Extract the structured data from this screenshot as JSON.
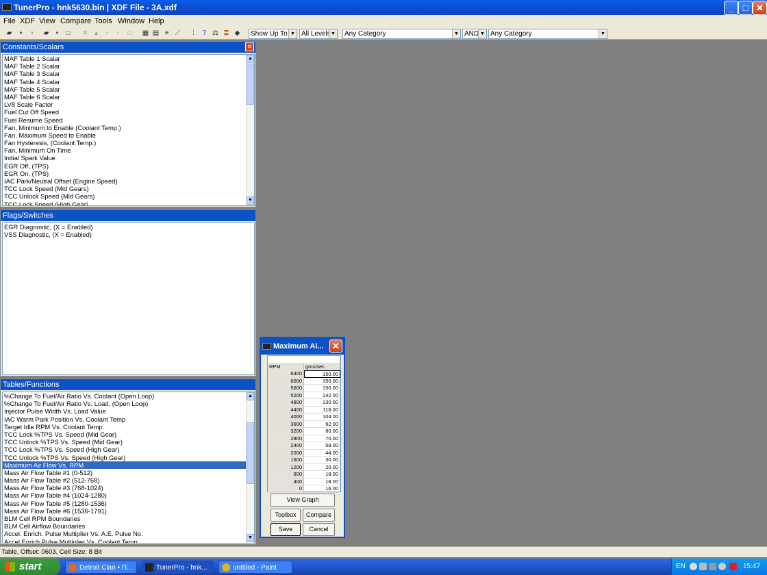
{
  "window": {
    "title": "TunerPro - hnk5630.bin | XDF File - 3A.xdf",
    "min": "_",
    "max": "□",
    "close": "✕"
  },
  "menu": [
    "File",
    "XDF",
    "View",
    "Compare",
    "Tools",
    "Window",
    "Help"
  ],
  "toolbar": {
    "icons": [
      "open-icon",
      "save-icon",
      "unlock-icon",
      "open-xdf-icon",
      "save-xdf-icon",
      "xdf-icon",
      "new-icon",
      "cut-icon",
      "tool-a-icon",
      "tool-b-icon",
      "tool-c-icon",
      "tool-d-icon",
      "table-icon",
      "table2-icon",
      "list-icon",
      "graph-icon",
      "gauge-icon",
      "help-icon",
      "balance-icon",
      "stack-icon",
      "chip-icon"
    ],
    "combo_show": "Show Up To",
    "combo_levels": "All Levels",
    "combo_category1": "Any Category",
    "combo_and": "AND",
    "combo_category2": "Any Category"
  },
  "constants": {
    "title": "Constants/Scalars",
    "items": [
      "MAF Table 1 Scalar",
      "MAF Table 2 Scalar",
      "MAF Table 3 Scalar",
      "MAF Table 4 Scalar",
      "MAF Table 5 Scalar",
      "MAF Table 6 Scalar",
      "LV8 Scale Factor",
      "Fuel Cut Off Speed",
      "Fuel  Resume Speed",
      "Fan, Minimum to Enable (Coolant Temp.)",
      "Fan. Maximum Speed to Enable",
      "Fan Hysteresis, (Coolant Temp.)",
      "Fan, Minimum On Time",
      "Initial  Spark Value",
      "EGR Off, (TPS)",
      "EGR On, (TPS)",
      "IAC Park/Neutral Offset (Engine Speed)",
      "TCC Lock Speed (Mid Gears)",
      "TCC Unlock Speed (Mid Gears)",
      "TCC Lock Speed (High Gear)"
    ]
  },
  "flags": {
    "title": "Flags/Switches",
    "items": [
      "EGR Diagnostic, (X = Enabled)",
      "VSS Diagnostic, (X = Enabled)"
    ]
  },
  "tables": {
    "title": "Tables/Functions",
    "selected_index": 9,
    "items": [
      "%Change To Fuel/Air Ratio Vs. Coolant (Open Loop)",
      "%Change To Fuel/Air Ratio Vs. Load, (Open Loop)",
      "Injector Pulse Width Vs. Load Value",
      "IAC Warm Park Position Vs. Coolant Temp",
      "Target Idle RPM Vs. Coolant Temp.",
      "TCC Lock %TPS Vs. Speed (Mid Gear)",
      "TCC Unlock %TPS Vs. Speed (Mid Gear)",
      "TCC Lock %TPS Vs. Speed (High Gear)",
      "TCC Unlock %TPS Vs. Speed (High Gear)",
      "Maximum  Air Flow Vs. RPM",
      "Mass Air Flow Table #1  (0-512)",
      "Mass Air Flow Table #2  (512-768)",
      "Mass Air Flow Table #3  (768-1024)",
      "Mass Air Flow Table #4  (1024-1280)",
      "Mass Air Flow Table #5  (1280-1536)",
      "Mass Air Flow Table #6  (1536-1791)",
      "BLM Cell RPM Boundaries",
      "BLM Cell Airflow Boundaries",
      "Accel. Enrich. Pulse Multiplier Vs. A.E. Pulse No.",
      "Accel Enrich Pulse Multiplier Vs. Coolant Temp"
    ]
  },
  "dialog": {
    "title": "Maximum  Ai...",
    "col_rpm": "RPM",
    "col_val": "gms/sec",
    "rows": [
      [
        "6400",
        "150.00"
      ],
      [
        "6000",
        "150.00"
      ],
      [
        "5600",
        "150.00"
      ],
      [
        "5200",
        "142.00"
      ],
      [
        "4800",
        "130.00"
      ],
      [
        "4400",
        "118.00"
      ],
      [
        "4000",
        "104.00"
      ],
      [
        "3600",
        "92.00"
      ],
      [
        "3200",
        "80.00"
      ],
      [
        "2800",
        "70.00"
      ],
      [
        "2400",
        "58.00"
      ],
      [
        "2000",
        "44.00"
      ],
      [
        "1600",
        "30.00"
      ],
      [
        "1200",
        "20.00"
      ],
      [
        "800",
        "18.00"
      ],
      [
        "400",
        "18.00"
      ],
      [
        "0",
        "16.00"
      ]
    ],
    "btn_graph": "View Graph",
    "btn_toolbox": "Toolbox",
    "btn_compare": "Compare",
    "btn_save": "Save",
    "btn_cancel": "Cancel"
  },
  "status": "Table, Offset: 0603,  Cell Size: 8 Bit",
  "taskbar": {
    "start": "start",
    "tasks": [
      {
        "label": "Detroit Clan • П...",
        "color": "#e06a1d"
      },
      {
        "label": "TunerPro - hnk...",
        "color": "#222222"
      },
      {
        "label": "untitled - Paint",
        "color": "#e0b020"
      }
    ],
    "lang": "EN",
    "clock": "15:47"
  }
}
